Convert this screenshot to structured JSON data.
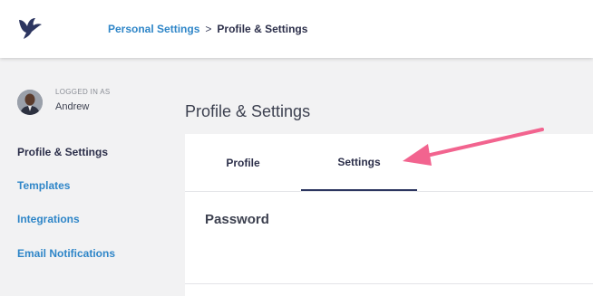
{
  "header": {
    "breadcrumb": {
      "parent": "Personal Settings",
      "separator": ">",
      "current": "Profile & Settings"
    },
    "logo_icon": "bird-logo-icon"
  },
  "sidebar": {
    "logged_in_label": "LOGGED IN AS",
    "user_name": "Andrew",
    "items": [
      {
        "label": "Profile & Settings",
        "active": true
      },
      {
        "label": "Templates",
        "active": false
      },
      {
        "label": "Integrations",
        "active": false
      },
      {
        "label": "Email Notifications",
        "active": false
      }
    ]
  },
  "main": {
    "page_title": "Profile & Settings",
    "tabs": [
      {
        "label": "Profile",
        "active": false
      },
      {
        "label": "Settings",
        "active": true
      }
    ],
    "section_title": "Password"
  },
  "colors": {
    "link": "#2f86c8",
    "text_dark": "#2c2f4a",
    "annotation_arrow": "#f2648f",
    "background": "#f2f2f3"
  }
}
